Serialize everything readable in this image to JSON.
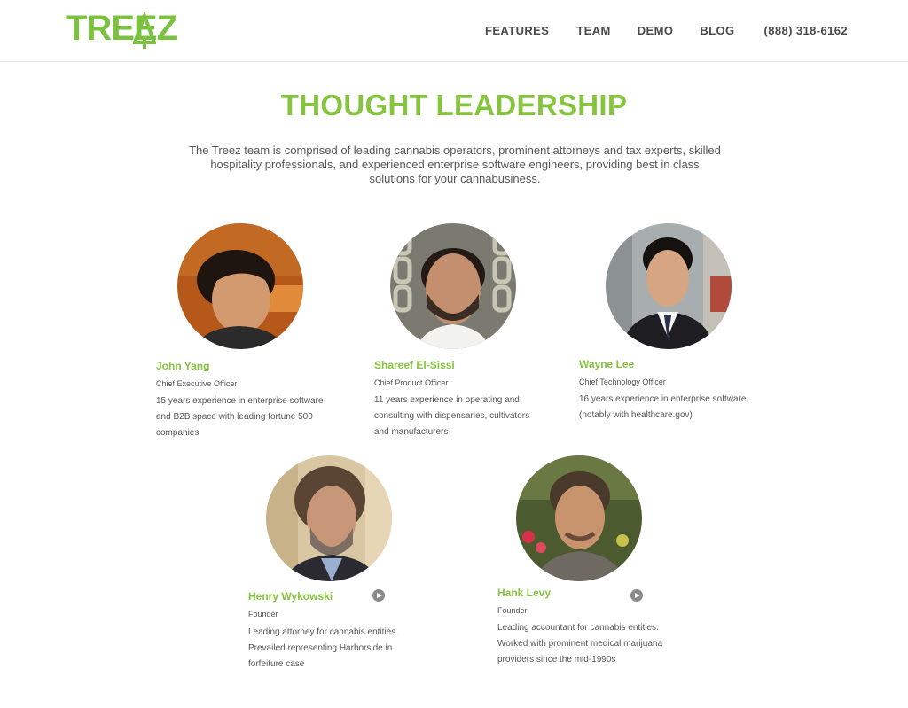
{
  "brand": {
    "logo_text": "TREEZ"
  },
  "nav": {
    "items": [
      "FEATURES",
      "TEAM",
      "DEMO",
      "BLOG"
    ],
    "phone": "(888) 318-6162"
  },
  "hero": {
    "title": "THOUGHT LEADERSHIP",
    "intro_lines": [
      "The Treez team is comprised of leading cannabis operators, prominent attorneys and tax experts, skilled",
      "hospitality professionals, and experienced enterprise software engineers, providing best in class",
      "solutions for your cannabusiness."
    ]
  },
  "team": [
    {
      "name": "John Yang",
      "role": "Chief Executive Officer",
      "bio_lines": [
        "15 years experience in enterprise software",
        "and B2B space with leading fortune 500",
        "companies"
      ]
    },
    {
      "name": "Shareef El-Sissi",
      "role": "Chief Product Officer",
      "bio_lines": [
        "11 years experience in operating and",
        "consulting with dispensaries, cultivators",
        "and manufacturers"
      ]
    },
    {
      "name": "Wayne Lee",
      "role": "Chief Technology Officer",
      "bio_lines": [
        "16 years experience in enterprise software",
        "(notably with healthcare.gov)"
      ]
    },
    {
      "name": "Henry Wykowski",
      "role": "Founder",
      "bio_lines": [
        "Leading attorney for cannabis entities.",
        "Prevailed representing Harborside in",
        "forfeiture case"
      ]
    },
    {
      "name": "Hank Levy",
      "role": "Founder",
      "bio_lines": [
        "Leading accountant for cannabis entities.",
        "Worked with prominent medical marijuana",
        "providers since the mid-1990s"
      ]
    }
  ],
  "colors": {
    "brand_green": "#86c440",
    "text": "#555555",
    "nav_text": "#4a4a4a"
  }
}
